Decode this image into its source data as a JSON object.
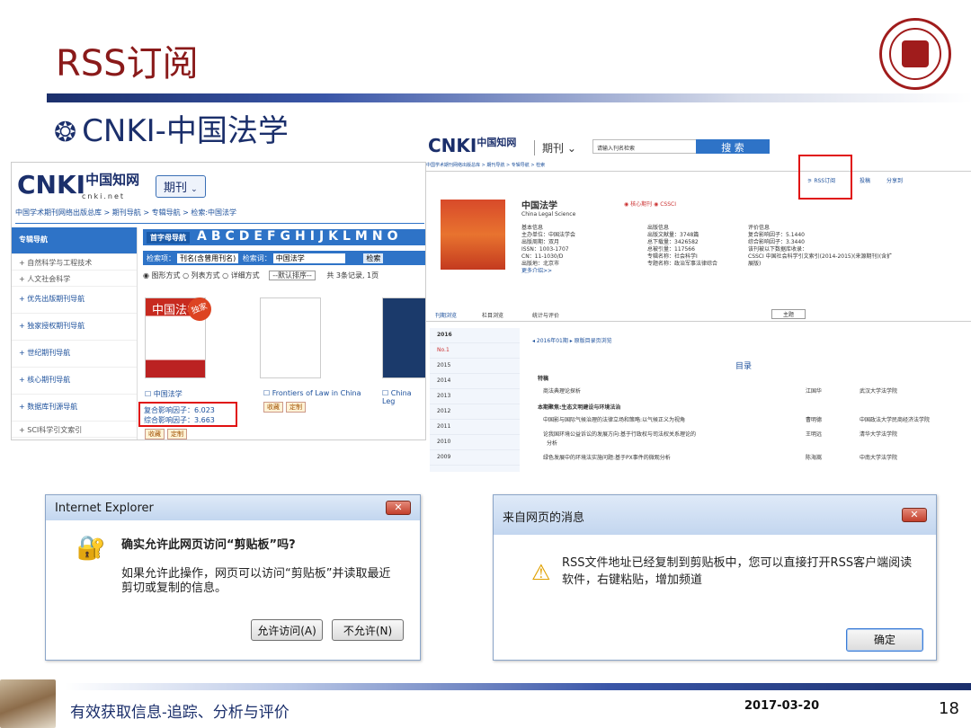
{
  "slide": {
    "title": "RSS订阅",
    "subtitle": "CNKI-中国法学",
    "footer_text": "有效获取信息-追踪、分析与评价",
    "footer_date": "2017-03-20",
    "page_number": "18"
  },
  "shot_left": {
    "logo": "CNKI",
    "logo_cn": "中国知网",
    "logo_url": "cnki.net",
    "section_button": "期刊",
    "breadcrumb": "中国学术期刊网络出版总库 > 期刊导航 > 专辑导航 > 检索:中国法学",
    "nav": [
      "专辑导航",
      "自然科学与工程技术",
      "人文社会科学",
      "优先出版期刊导航",
      "独家授权期刊导航",
      "世纪期刊导航",
      "核心期刊导航",
      "数据库刊源导航",
      "SCI科学引文索引"
    ],
    "az_label": "首字母导航",
    "az": "ABCDEFGHIJKLMNO",
    "search_label": "检索项：",
    "search_field": "刊名(含曾用刊名)",
    "search_kw_label": "检索词：",
    "search_kw": "中国法学",
    "search_btn": "检索",
    "mode1": "图形方式",
    "mode2": "列表方式",
    "mode3": "详细方式",
    "sort": "--默认排序--",
    "count": "共 3条记录, 1页",
    "journals": [
      "中国法学",
      "Frontiers of Law in China",
      "China Leg"
    ],
    "badge": "独家",
    "impact1": "复合影响因子：6.023",
    "impact2": "综合影响因子：3.663",
    "fav": "收藏",
    "custom": "定制"
  },
  "shot_right": {
    "section": "期刊",
    "search_placeholder": "请输入刊名检索",
    "search_btn": "搜 索",
    "breadcrumb": "中国学术期刊网络出版总库 > 期刊导航 > 专辑导航 > 检索",
    "rss": "RSS订阅",
    "submit": "投稿",
    "share": "分享到",
    "journal_cn": "中国法学",
    "journal_en": "China Legal Science",
    "tag1": "核心期刊",
    "tag2": "CSSCI",
    "basic_title": "基本信息",
    "basic": [
      "主办单位：中国法学会",
      "出版周期：双月",
      "ISSN：1003-1707",
      "CN：11-1030/D",
      "出版地：北京市",
      "更多介绍>>"
    ],
    "pub_title": "出版信息",
    "pub": [
      "出版文献量：3748篇",
      "总下载量：3426582",
      "总被引量：117566",
      "专辑名称：社会科学I",
      "专题名称：政治军事法律综合"
    ],
    "eval_title": "评价信息",
    "eval": [
      "复合影响因子：5.1440",
      "综合影响因子：3.3440",
      "该刊被以下数据库收录：",
      "CSSCI 中国社会科学引文索引(2014-2015)(来源期刊)(含扩",
      "展版)"
    ],
    "tabs": [
      "刊期浏览",
      "栏目浏览",
      "统计与评价"
    ],
    "theme": "主题",
    "issue_label": "2016年01期",
    "toc_link": "原版目录页浏览",
    "toc": "目录",
    "years": [
      "2016",
      "No.1",
      "2015",
      "2014",
      "2013",
      "2012",
      "2011",
      "2010",
      "2009"
    ],
    "sec1": "特稿",
    "art1": "商法典理论探析",
    "auth1": "江国华",
    "inst1": "武汉大学法学院",
    "sec2": "本期聚焦:生态文明建设与环境法治",
    "articles": [
      {
        "t": "中国影与国际气候治理的法律立场和策略:以气候正义为视角",
        "a": "曹明德",
        "i": "中国政法大学民商经济法学院"
      },
      {
        "t": "论我国环境公益诉讼的发展方向:基于行政权与司法权关系理论的",
        "a": "王明远",
        "i": "清华大学法学院"
      },
      {
        "t": "分析",
        "a": "",
        "i": ""
      },
      {
        "t": "绿色发展中的环境法实施问题:基于PX事件的微观分析",
        "a": "陈海嵩",
        "i": "中南大学法学院"
      }
    ]
  },
  "dialog_ie": {
    "title": "Internet Explorer",
    "question": "确实允许此网页访问“剪贴板”吗?",
    "body": "如果允许此操作，网页可以访问“剪贴板”并读取最近剪切或复制的信息。",
    "allow": "允许访问(A)",
    "deny": "不允许(N)"
  },
  "dialog_msg": {
    "title": "来自网页的消息",
    "body": "RSS文件地址已经复制到剪贴板中，您可以直接打开RSS客户端阅读软件，右键粘贴，增加频道",
    "ok": "确定"
  },
  "colors": {
    "accent": "#8a1a1a",
    "navy": "#1b2f6b",
    "cnki_blue": "#2e73c7",
    "highlight": "#e01010"
  }
}
